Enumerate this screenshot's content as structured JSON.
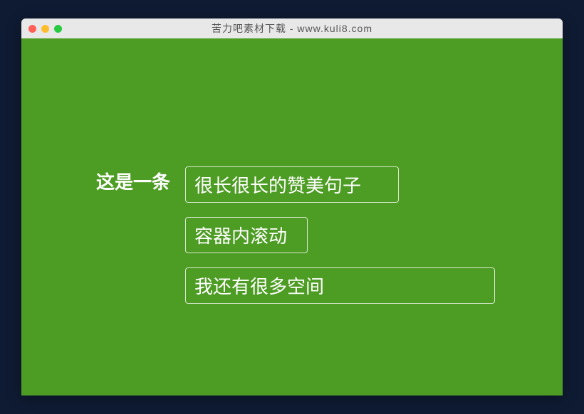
{
  "window": {
    "title": "苦力吧素材下载 - www.kuli8.com"
  },
  "content": {
    "label": "这是一条",
    "boxes": [
      "很长很长的赞美句子",
      "容器内滚动",
      "我还有很多空间"
    ]
  }
}
